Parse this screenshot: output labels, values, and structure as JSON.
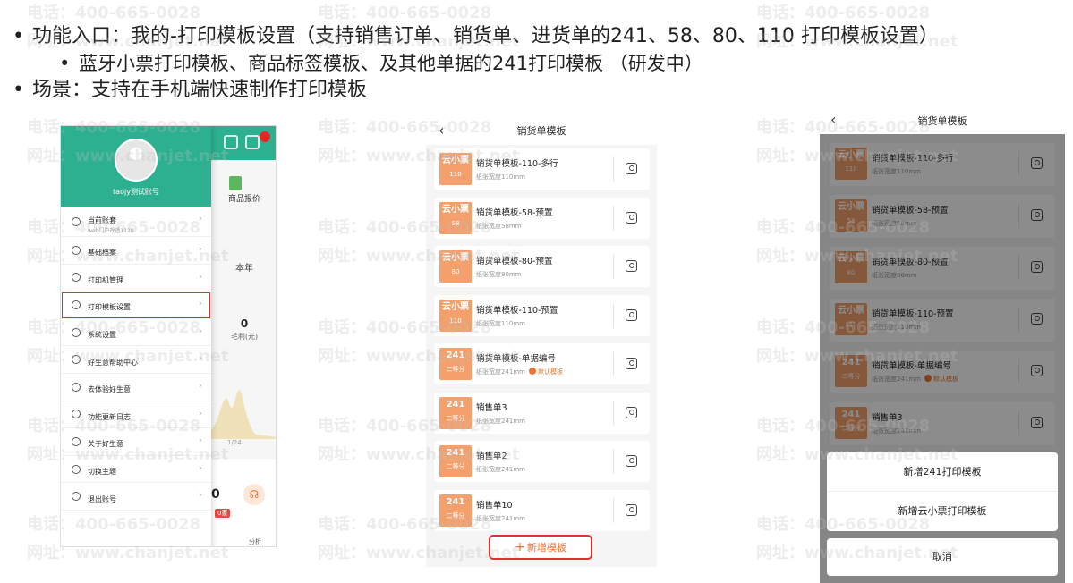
{
  "bullets": {
    "marker": "•",
    "line1": "功能入口：我的-打印模板设置（支持销售订单、销货单、进货单的241、58、80、110 打印模板设置）",
    "line2": "蓝牙小票打印模板、商品标签模板、及其他单据的241打印模板 （研发中）",
    "line3": "场景：支持在手机端快速制作打印模板"
  },
  "watermark": {
    "phone": "电话：400-665-0028",
    "site": "网址：www.chanjet.net"
  },
  "phone1": {
    "username": "taojy测试账号",
    "menu": [
      {
        "label": "当前账套",
        "sub": "web门户改造1120",
        "icon": "account-icon"
      },
      {
        "label": "基础档案",
        "sub": "",
        "icon": "archive-icon"
      },
      {
        "label": "打印机管理",
        "sub": "",
        "icon": "printer-icon"
      },
      {
        "label": "打印模板设置",
        "sub": "",
        "icon": "template-icon"
      },
      {
        "label": "系统设置",
        "sub": "",
        "icon": "gear-icon"
      },
      {
        "label": "好生意帮助中心",
        "sub": "",
        "icon": "help-icon"
      },
      {
        "label": "去体验好生意",
        "sub": "",
        "icon": "experience-icon"
      },
      {
        "label": "功能更新日志",
        "sub": "",
        "icon": "log-icon"
      },
      {
        "label": "关于好生意",
        "sub": "",
        "icon": "info-icon"
      },
      {
        "label": "切换主题",
        "sub": "",
        "icon": "theme-icon"
      },
      {
        "label": "退出账号",
        "sub": "",
        "icon": "logout-icon"
      }
    ],
    "right": {
      "shop_label": "商品报价",
      "year": "本年",
      "zero": "0",
      "profit_label": "毛利(元)",
      "x_label": "1/24",
      "bottom_zero": "0",
      "bottom_tag": "0家",
      "analysis": "分析"
    }
  },
  "phone2": {
    "title": "销货单模板",
    "cards": [
      {
        "thumb_top": "云小票",
        "thumb_bot": "110",
        "name": "销货单模板-110-多行",
        "width": "纸张宽度110mm",
        "default": ""
      },
      {
        "thumb_top": "云小票",
        "thumb_bot": "58",
        "name": "销货单模板-58-预置",
        "width": "纸张宽度58mm",
        "default": ""
      },
      {
        "thumb_top": "云小票",
        "thumb_bot": "80",
        "name": "销货单模板-80-预置",
        "width": "纸张宽度80mm",
        "default": ""
      },
      {
        "thumb_top": "云小票",
        "thumb_bot": "110",
        "name": "销货单模板-110-预置",
        "width": "纸张宽度110mm",
        "default": ""
      },
      {
        "thumb_top": "241",
        "thumb_bot": "二等分",
        "name": "销货单模板-单据编号",
        "width": "纸张宽度241mm",
        "default": "默认模板"
      },
      {
        "thumb_top": "241",
        "thumb_bot": "二等分",
        "name": "销售单3",
        "width": "纸张宽度241mm",
        "default": ""
      },
      {
        "thumb_top": "241",
        "thumb_bot": "二等分",
        "name": "销售单2",
        "width": "纸张宽度241mm",
        "default": ""
      },
      {
        "thumb_top": "241",
        "thumb_bot": "二等分",
        "name": "销售单10",
        "width": "纸张宽度241mm",
        "default": ""
      }
    ],
    "add_button": "新增模板",
    "add_plus": "+"
  },
  "phone3": {
    "title": "销货单模板",
    "cards": [
      {
        "thumb_top": "云小票",
        "thumb_bot": "110",
        "name": "销货单模板-110-多行",
        "width": "纸张宽度110mm",
        "default": ""
      },
      {
        "thumb_top": "云小票",
        "thumb_bot": "58",
        "name": "销货单模板-58-预置",
        "width": "纸张宽度58mm",
        "default": ""
      },
      {
        "thumb_top": "云小票",
        "thumb_bot": "80",
        "name": "销货单模板-80-预置",
        "width": "纸张宽度80mm",
        "default": ""
      },
      {
        "thumb_top": "云小票",
        "thumb_bot": "110",
        "name": "销货单模板-110-预置",
        "width": "纸张宽度110mm",
        "default": ""
      },
      {
        "thumb_top": "241",
        "thumb_bot": "二等分",
        "name": "销货单模板-单据编号",
        "width": "纸张宽度241mm",
        "default": "默认模板"
      },
      {
        "thumb_top": "241",
        "thumb_bot": "二等分",
        "name": "销售单3",
        "width": "纸张宽度241mm",
        "default": ""
      }
    ],
    "sheet_options": [
      "新增241打印模板",
      "新增云小票打印模板"
    ],
    "cancel": "取消"
  },
  "back_glyph": "‹",
  "chevron_glyph": "›"
}
